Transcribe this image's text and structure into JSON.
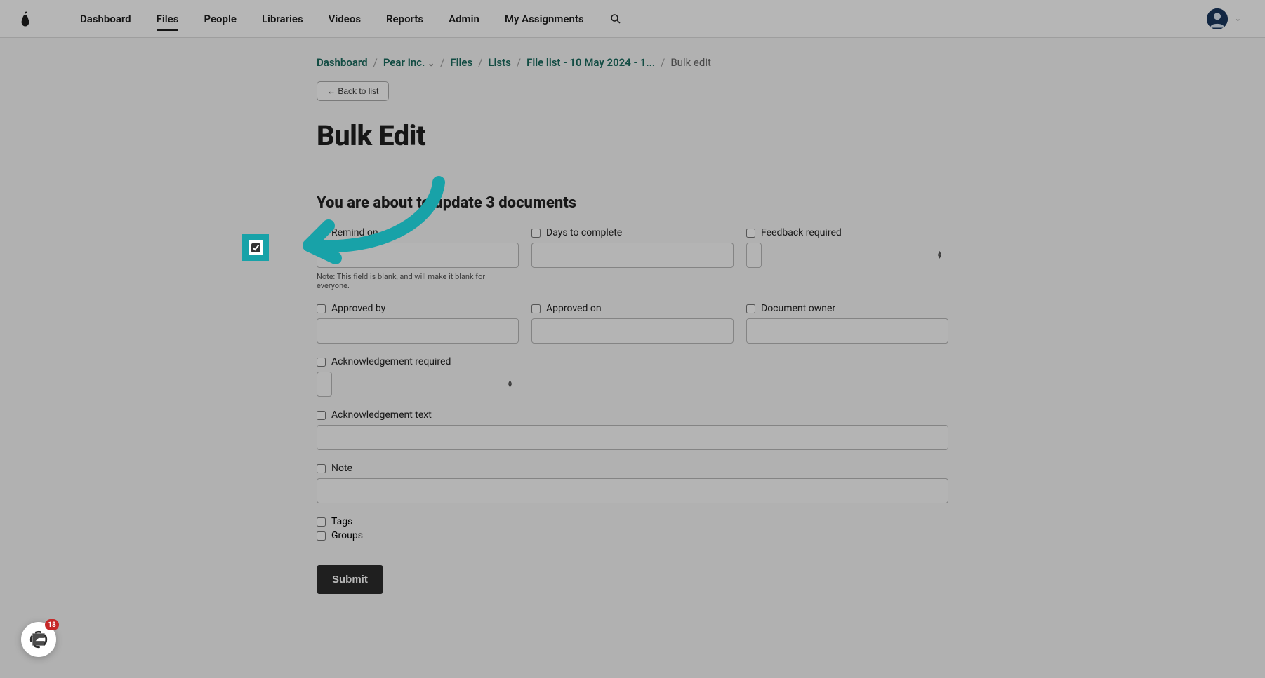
{
  "nav": {
    "items": [
      {
        "label": "Dashboard",
        "active": false
      },
      {
        "label": "Files",
        "active": true
      },
      {
        "label": "People",
        "active": false
      },
      {
        "label": "Libraries",
        "active": false
      },
      {
        "label": "Videos",
        "active": false
      },
      {
        "label": "Reports",
        "active": false
      },
      {
        "label": "Admin",
        "active": false
      },
      {
        "label": "My Assignments",
        "active": false
      }
    ]
  },
  "breadcrumb": {
    "items": [
      {
        "label": "Dashboard"
      },
      {
        "label": "Pear Inc.",
        "hasDropdown": true
      },
      {
        "label": "Files"
      },
      {
        "label": "Lists"
      },
      {
        "label": "File list - 10 May 2024 - 1..."
      }
    ],
    "current": "Bulk edit"
  },
  "back_button": "← Back to list",
  "page_title": "Bulk Edit",
  "subtitle": "You are about to update 3 documents",
  "fields": {
    "remind_on": {
      "label": "Remind on",
      "checked": true,
      "help": "Note: This field is blank, and will make it blank for everyone."
    },
    "days_to_complete": {
      "label": "Days to complete",
      "checked": false
    },
    "feedback_required": {
      "label": "Feedback required",
      "checked": false
    },
    "approved_by": {
      "label": "Approved by",
      "checked": false
    },
    "approved_on": {
      "label": "Approved on",
      "checked": false
    },
    "document_owner": {
      "label": "Document owner",
      "checked": false
    },
    "ack_required": {
      "label": "Acknowledgement required",
      "checked": false
    },
    "ack_text": {
      "label": "Acknowledgement text",
      "checked": false
    },
    "note": {
      "label": "Note",
      "checked": false
    },
    "tags": {
      "label": "Tags",
      "checked": false
    },
    "groups": {
      "label": "Groups",
      "checked": false
    }
  },
  "submit_label": "Submit",
  "chat_badge": "18"
}
